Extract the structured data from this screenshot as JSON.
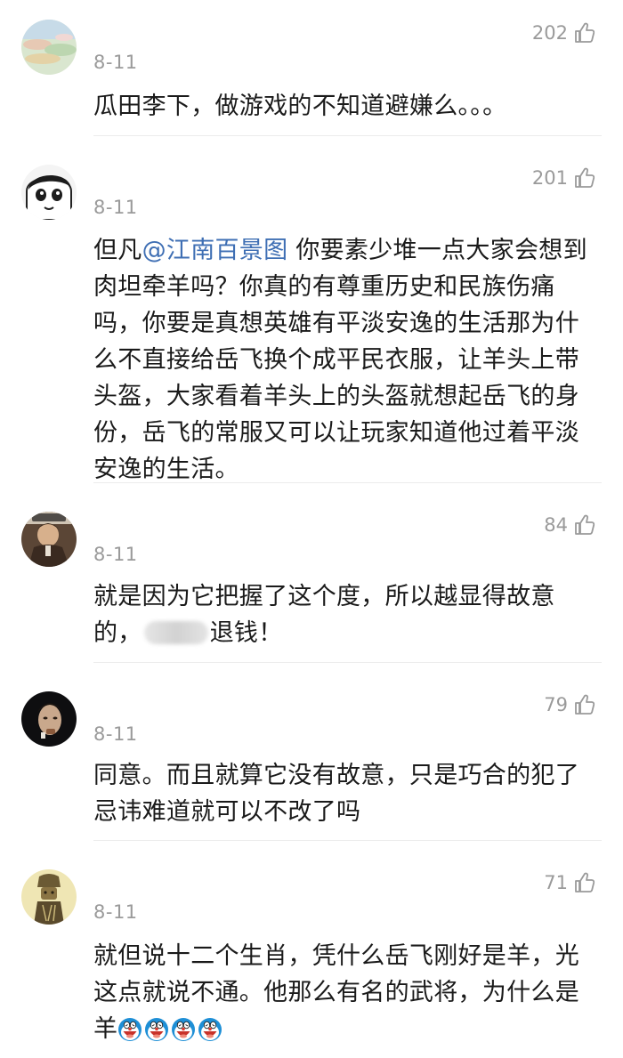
{
  "comments": [
    {
      "date": "8-11",
      "likes": "202",
      "text": "瓜田李下，做游戏的不知道避嫌么。。。"
    },
    {
      "date": "8-11",
      "likes": "201",
      "prefix": "但凡",
      "mention": "@江南百景图",
      "text": " 你要素少堆一点大家会想到肉坦牵羊吗？你真的有尊重历史和民族伤痛吗，你要是真想英雄有平淡安逸的生活那为什么不直接给岳飞换个成平民衣服，让羊头上带头盔，大家看着羊头上的头盔就想起岳飞的身份，岳飞的常服又可以让玩家知道他过着平淡安逸的生活。"
    },
    {
      "date": "8-11",
      "likes": "84",
      "text_before": "就是因为它把握了这个度，所以越显得故意的，",
      "text_after": "退钱！"
    },
    {
      "date": "8-11",
      "likes": "79",
      "text": "同意。而且就算它没有故意，只是巧合的犯了忌讳难道就可以不改了吗"
    },
    {
      "date": "8-11",
      "likes": "71",
      "text": "就但说十二个生肖，凭什么岳飞刚好是羊，光这点就说不通。他那么有名的武将，为什么是羊",
      "emoji": [
        "doraemon-laugh-icon",
        "doraemon-laugh-icon",
        "doraemon-laugh-icon",
        "doraemon-laugh-icon"
      ]
    }
  ],
  "icons": {
    "like": "thumbs-up-icon"
  },
  "colors": {
    "mention": "#3f6fb4",
    "meta": "#9a9a9a",
    "text": "#1a1a1a"
  }
}
